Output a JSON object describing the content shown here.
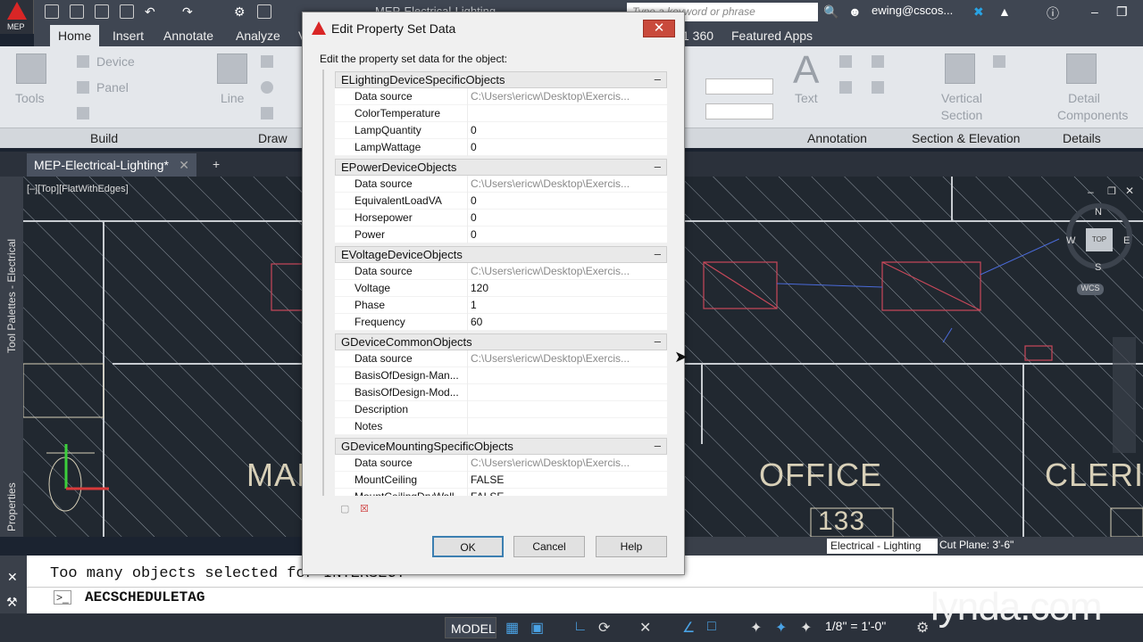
{
  "app": {
    "menu_label": "MEP",
    "search_placeholder": "Type a keyword or phrase",
    "user": "ewing@cscos...",
    "background_title": "MEP-Electrical-Lighting..."
  },
  "ribbon": {
    "tabs": [
      "Home",
      "Insert",
      "Annotate",
      "Analyze",
      "V",
      "1 360",
      "Featured Apps"
    ],
    "active_tab": "Home",
    "panels": [
      "Build",
      "Draw",
      "Annotation",
      "Section & Elevation",
      "Details"
    ],
    "tools": {
      "tools_label": "Tools",
      "device_label": "Device",
      "panel_label": "Panel",
      "line_label": "Line",
      "text_label": "Text",
      "vertical_section_label": "Vertical Section",
      "detail_components_label": "Detail Components"
    }
  },
  "document": {
    "tab_label": "MEP-Electrical-Lighting*",
    "view_label": "[–][Top][FlatWithEdges]",
    "room_labels": [
      "MAIN",
      "OFFICE",
      "CLERIC"
    ],
    "room_number": "133",
    "left_palettes": [
      "Tool Palettes - Electrical",
      "Properties"
    ]
  },
  "viewcube": {
    "n": "N",
    "s": "S",
    "e": "E",
    "w": "W",
    "top": "TOP",
    "wcs": "WCS"
  },
  "command": {
    "history": "Too many objects selected for INTERSECT",
    "current": "AECSCHEDULETAG"
  },
  "status": {
    "layer": "Electrical - Lighting",
    "cut_plane": "Cut Plane: 3'-6\"",
    "model": "MODEL",
    "scale": "1/8\" = 1'-0\""
  },
  "watermark": "lynda.com",
  "dialog": {
    "title": "Edit Property Set Data",
    "close": "✕",
    "intro": "Edit the property set data for the object:",
    "collapse_glyph": "–",
    "groups": [
      {
        "name": "ELightingDeviceSpecificObjects",
        "rows": [
          {
            "k": "Data source",
            "v": "C:\\Users\\ericw\\Desktop\\Exercis...",
            "dim": true
          },
          {
            "k": "ColorTemperature",
            "v": "",
            "dim": false
          },
          {
            "k": "LampQuantity",
            "v": "0",
            "dim": false
          },
          {
            "k": "LampWattage",
            "v": "0",
            "dim": false
          }
        ]
      },
      {
        "name": "EPowerDeviceObjects",
        "rows": [
          {
            "k": "Data source",
            "v": "C:\\Users\\ericw\\Desktop\\Exercis...",
            "dim": true
          },
          {
            "k": "EquivalentLoadVA",
            "v": "0",
            "dim": false
          },
          {
            "k": "Horsepower",
            "v": "0",
            "dim": false
          },
          {
            "k": "Power",
            "v": "0",
            "dim": false
          }
        ]
      },
      {
        "name": "EVoltageDeviceObjects",
        "rows": [
          {
            "k": "Data source",
            "v": "C:\\Users\\ericw\\Desktop\\Exercis...",
            "dim": true
          },
          {
            "k": "Voltage",
            "v": "120",
            "dim": false
          },
          {
            "k": "Phase",
            "v": "1",
            "dim": false
          },
          {
            "k": "Frequency",
            "v": "60",
            "dim": false
          }
        ]
      },
      {
        "name": "GDeviceCommonObjects",
        "rows": [
          {
            "k": "Data source",
            "v": "C:\\Users\\ericw\\Desktop\\Exercis...",
            "dim": true
          },
          {
            "k": "BasisOfDesign-Man...",
            "v": "",
            "dim": false
          },
          {
            "k": "BasisOfDesign-Mod...",
            "v": "",
            "dim": false
          },
          {
            "k": "Description",
            "v": "",
            "dim": false
          },
          {
            "k": "Notes",
            "v": "",
            "dim": false
          }
        ]
      },
      {
        "name": "GDeviceMountingSpecificObjects",
        "rows": [
          {
            "k": "Data source",
            "v": "C:\\Users\\ericw\\Desktop\\Exercis...",
            "dim": true
          },
          {
            "k": "MountCeiling",
            "v": "FALSE",
            "dim": false
          },
          {
            "k": "MountCeilingDryWall",
            "v": "FALSE",
            "dim": false
          }
        ]
      }
    ],
    "buttons": {
      "ok": "OK",
      "cancel": "Cancel",
      "help": "Help"
    }
  },
  "colors": {
    "canvas_bg": "#212830",
    "linework": "#9aa3ad",
    "red_fixtures": "#c9485a",
    "accent": "#3c7fb1"
  }
}
